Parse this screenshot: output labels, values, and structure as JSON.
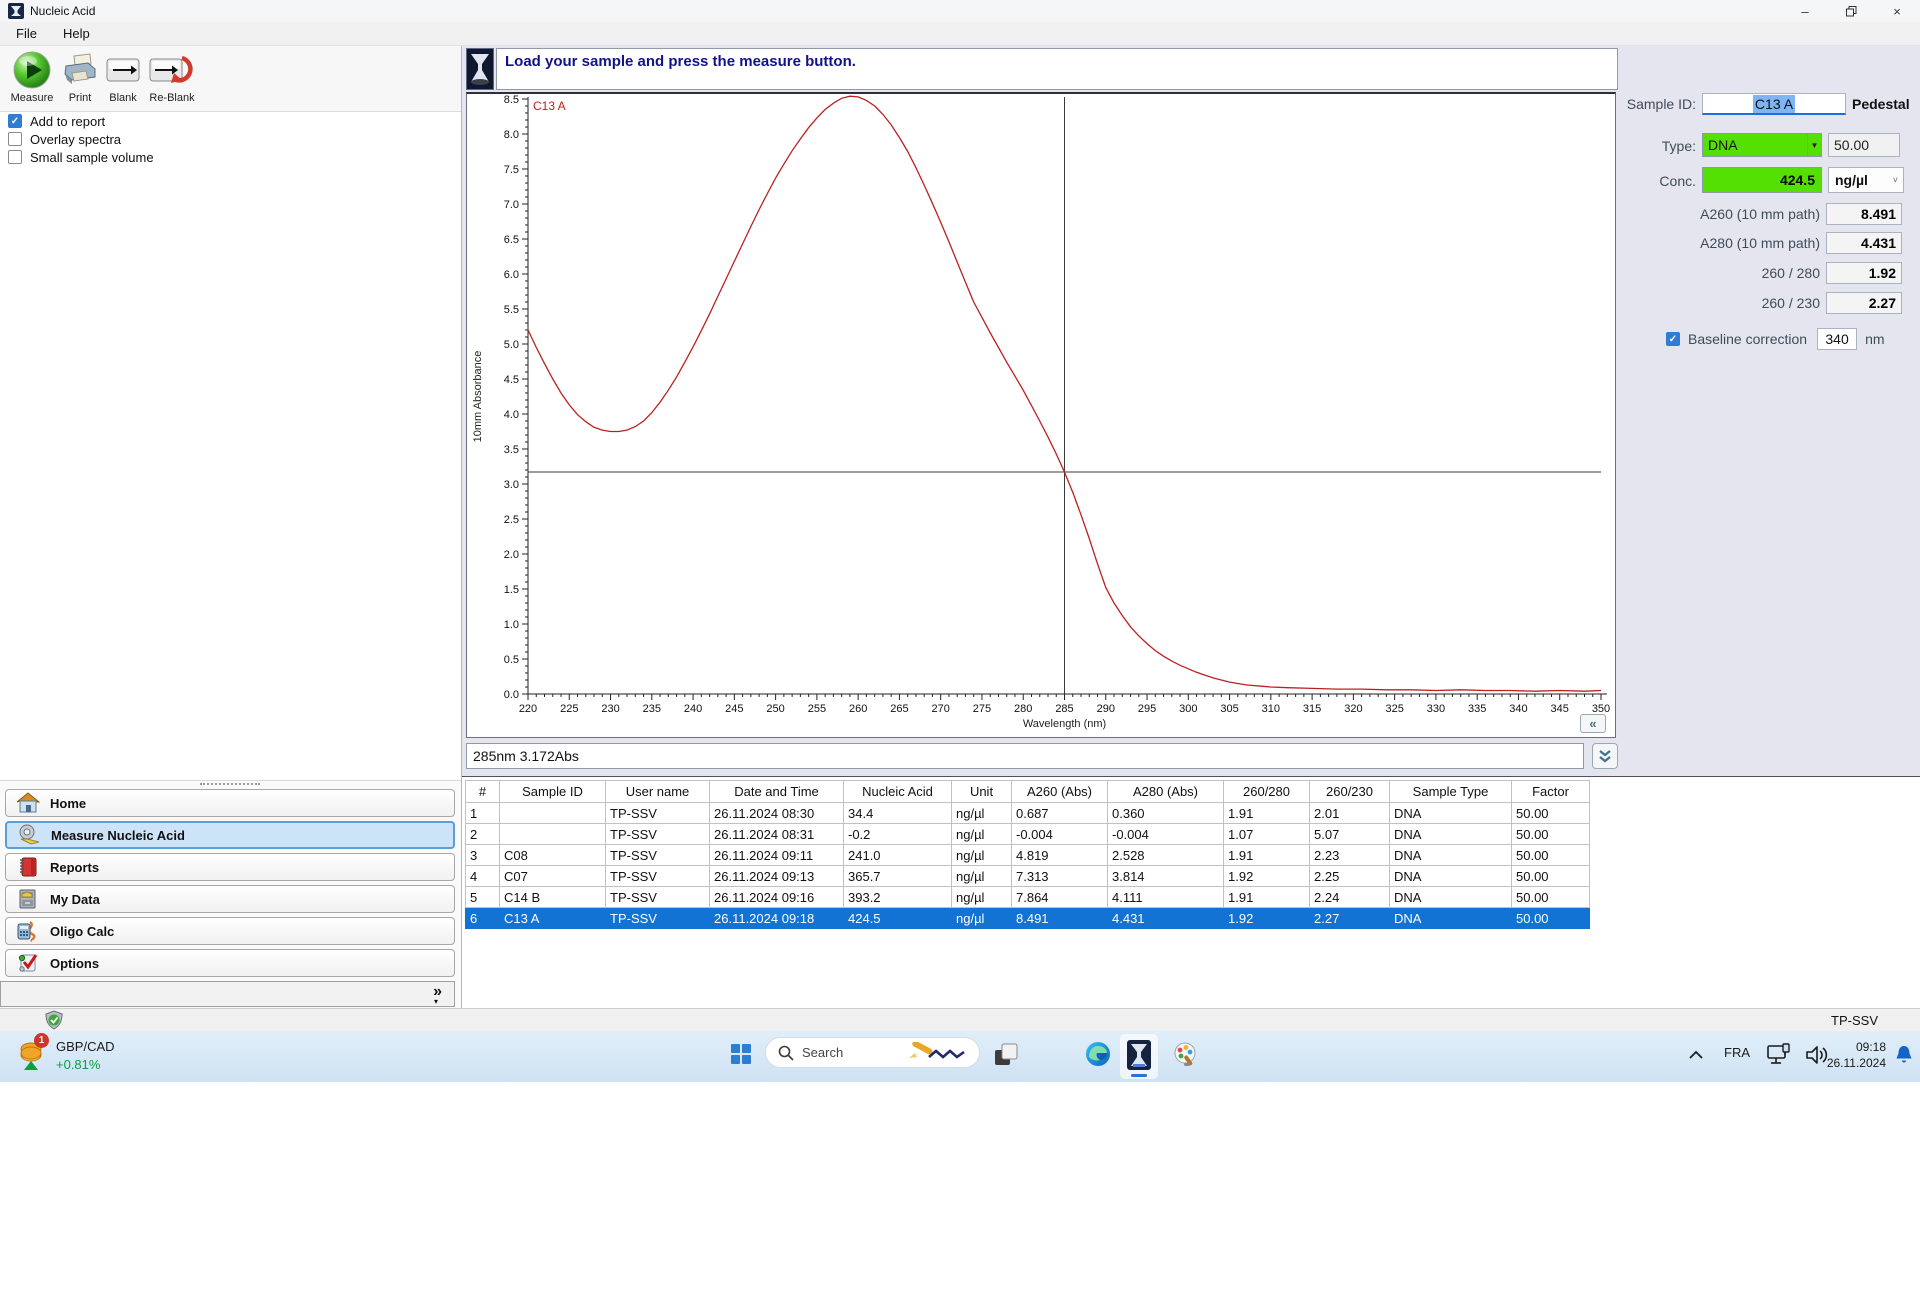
{
  "window": {
    "title": "Nucleic Acid",
    "minimize_glyph": "–",
    "close_glyph": "×"
  },
  "menu": {
    "items": [
      {
        "label": "File"
      },
      {
        "label": "Help"
      }
    ]
  },
  "toolbar": {
    "buttons": [
      {
        "label": "Measure"
      },
      {
        "label": "Print"
      },
      {
        "label": "Blank"
      },
      {
        "label": "Re-Blank"
      }
    ]
  },
  "options_checkboxes": [
    {
      "label": "Add to report",
      "checked": true
    },
    {
      "label": "Overlay spectra",
      "checked": false
    },
    {
      "label": "Small sample volume",
      "checked": false
    }
  ],
  "message_bar": {
    "text": "Load your sample and press the measure button."
  },
  "chart_data": {
    "type": "line",
    "xlabel": "Wavelength (nm)",
    "ylabel": "10mm Absorbance",
    "xlim": [
      220,
      350
    ],
    "ylim": [
      0,
      8.5
    ],
    "x_major_tick_step": 5,
    "y_major_tick_step": 0.5,
    "grid": false,
    "crosshair": {
      "x": 285,
      "y": 3.172
    },
    "series": [
      {
        "name": "C13 A",
        "color": "#bb2020",
        "points": [
          [
            220,
            5.2
          ],
          [
            221,
            4.95
          ],
          [
            222,
            4.72
          ],
          [
            223,
            4.5
          ],
          [
            224,
            4.3
          ],
          [
            225,
            4.13
          ],
          [
            226,
            3.99
          ],
          [
            227,
            3.89
          ],
          [
            228,
            3.81
          ],
          [
            229,
            3.77
          ],
          [
            230,
            3.75
          ],
          [
            231,
            3.75
          ],
          [
            232,
            3.77
          ],
          [
            233,
            3.82
          ],
          [
            234,
            3.9
          ],
          [
            235,
            4.02
          ],
          [
            236,
            4.17
          ],
          [
            237,
            4.34
          ],
          [
            238,
            4.53
          ],
          [
            239,
            4.74
          ],
          [
            240,
            4.96
          ],
          [
            241,
            5.19
          ],
          [
            242,
            5.43
          ],
          [
            243,
            5.68
          ],
          [
            244,
            5.93
          ],
          [
            245,
            6.18
          ],
          [
            246,
            6.43
          ],
          [
            247,
            6.68
          ],
          [
            248,
            6.92
          ],
          [
            249,
            7.15
          ],
          [
            250,
            7.37
          ],
          [
            251,
            7.57
          ],
          [
            252,
            7.76
          ],
          [
            253,
            7.93
          ],
          [
            254,
            8.09
          ],
          [
            255,
            8.23
          ],
          [
            256,
            8.35
          ],
          [
            257,
            8.44
          ],
          [
            258,
            8.51
          ],
          [
            259,
            8.54
          ],
          [
            260,
            8.53
          ],
          [
            261,
            8.48
          ],
          [
            262,
            8.4
          ],
          [
            263,
            8.28
          ],
          [
            264,
            8.13
          ],
          [
            265,
            7.95
          ],
          [
            266,
            7.75
          ],
          [
            267,
            7.52
          ],
          [
            268,
            7.27
          ],
          [
            269,
            7.01
          ],
          [
            270,
            6.74
          ],
          [
            271,
            6.46
          ],
          [
            272,
            6.17
          ],
          [
            273,
            5.88
          ],
          [
            274,
            5.6
          ],
          [
            275,
            5.38
          ],
          [
            276,
            5.16
          ],
          [
            277,
            4.95
          ],
          [
            278,
            4.74
          ],
          [
            279,
            4.54
          ],
          [
            280,
            4.34
          ],
          [
            281,
            4.12
          ],
          [
            282,
            3.9
          ],
          [
            283,
            3.67
          ],
          [
            284,
            3.43
          ],
          [
            285,
            3.17
          ],
          [
            286,
            2.88
          ],
          [
            287,
            2.56
          ],
          [
            288,
            2.22
          ],
          [
            289,
            1.86
          ],
          [
            290,
            1.52
          ],
          [
            291,
            1.3
          ],
          [
            292,
            1.12
          ],
          [
            293,
            0.96
          ],
          [
            294,
            0.83
          ],
          [
            295,
            0.72
          ],
          [
            296,
            0.62
          ],
          [
            297,
            0.54
          ],
          [
            298,
            0.47
          ],
          [
            299,
            0.41
          ],
          [
            300,
            0.36
          ],
          [
            301,
            0.31
          ],
          [
            302,
            0.27
          ],
          [
            303,
            0.23
          ],
          [
            304,
            0.2
          ],
          [
            305,
            0.17
          ],
          [
            306,
            0.15
          ],
          [
            307,
            0.13
          ],
          [
            308,
            0.12
          ],
          [
            309,
            0.11
          ],
          [
            310,
            0.1
          ],
          [
            312,
            0.09
          ],
          [
            315,
            0.08
          ],
          [
            318,
            0.07
          ],
          [
            321,
            0.07
          ],
          [
            324,
            0.06
          ],
          [
            327,
            0.06
          ],
          [
            330,
            0.05
          ],
          [
            333,
            0.06
          ],
          [
            336,
            0.05
          ],
          [
            339,
            0.05
          ],
          [
            342,
            0.04
          ],
          [
            345,
            0.05
          ],
          [
            348,
            0.04
          ],
          [
            350,
            0.05
          ]
        ]
      }
    ]
  },
  "chart_ui": {
    "collapse_glyph": "«",
    "cursor_readout": "285nm 3.172Abs"
  },
  "results_panel": {
    "sample_id_label": "Sample ID:",
    "sample_id_value": "C13 A",
    "mode_label": "Pedestal",
    "type_label": "Type:",
    "type_value": "DNA",
    "factor_value": "50.00",
    "conc_label": "Conc.",
    "conc_value": "424.5",
    "conc_unit": "ng/µl",
    "stat_rows": [
      {
        "label": "A260 (10 mm path)",
        "value": "8.491"
      },
      {
        "label": "A280 (10 mm path)",
        "value": "4.431"
      },
      {
        "label": "260 / 280",
        "value": "1.92"
      },
      {
        "label": "260 / 230",
        "value": "2.27"
      }
    ],
    "baseline_label": "Baseline correction",
    "baseline_value": "340",
    "baseline_unit": "nm"
  },
  "sidebar": {
    "selected_index": 1,
    "expand_glyph": "»",
    "items": [
      {
        "label": "Home"
      },
      {
        "label": "Measure Nucleic Acid"
      },
      {
        "label": "Reports"
      },
      {
        "label": "My Data"
      },
      {
        "label": "Oligo Calc"
      },
      {
        "label": "Options"
      }
    ]
  },
  "table": {
    "columns": [
      "#",
      "Sample ID",
      "User name",
      "Date and Time",
      "Nucleic Acid",
      "Unit",
      "A260 (Abs)",
      "A280 (Abs)",
      "260/280",
      "260/230",
      "Sample Type",
      "Factor"
    ],
    "selected_row_index": 5,
    "rows": [
      [
        "1",
        "",
        "TP-SSV",
        "26.11.2024 08:30",
        "34.4",
        "ng/µl",
        "0.687",
        "0.360",
        "1.91",
        "2.01",
        "DNA",
        "50.00"
      ],
      [
        "2",
        "",
        "TP-SSV",
        "26.11.2024 08:31",
        "-0.2",
        "ng/µl",
        "-0.004",
        "-0.004",
        "1.07",
        "5.07",
        "DNA",
        "50.00"
      ],
      [
        "3",
        "C08",
        "TP-SSV",
        "26.11.2024 09:11",
        "241.0",
        "ng/µl",
        "4.819",
        "2.528",
        "1.91",
        "2.23",
        "DNA",
        "50.00"
      ],
      [
        "4",
        "C07",
        "TP-SSV",
        "26.11.2024 09:13",
        "365.7",
        "ng/µl",
        "7.313",
        "3.814",
        "1.92",
        "2.25",
        "DNA",
        "50.00"
      ],
      [
        "5",
        "C14 B",
        "TP-SSV",
        "26.11.2024 09:16",
        "393.2",
        "ng/µl",
        "7.864",
        "4.111",
        "1.91",
        "2.24",
        "DNA",
        "50.00"
      ],
      [
        "6",
        "C13 A",
        "TP-SSV",
        "26.11.2024 09:18",
        "424.5",
        "ng/µl",
        "8.491",
        "4.431",
        "1.92",
        "2.27",
        "DNA",
        "50.00"
      ]
    ]
  },
  "status_bar": {
    "user": "TP-SSV"
  },
  "taskbar": {
    "widget": {
      "pair": "GBP/CAD",
      "change": "+0.81%",
      "badge": "1"
    },
    "search": {
      "placeholder": "Search"
    },
    "tray": {
      "language": "FRA",
      "time": "09:18",
      "date": "26.11.2024"
    }
  }
}
